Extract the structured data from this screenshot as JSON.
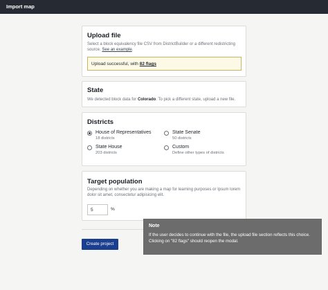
{
  "header": {
    "title": "Import map"
  },
  "upload": {
    "title": "Upload file",
    "description": "Select a block equivalency file CSV from DistrictBuilder or a different redistricting source.",
    "example_link": "See an example",
    "example_suffix": ".",
    "success_prefix": "Upload successful, with ",
    "success_link": "82 flags"
  },
  "state": {
    "title": "State",
    "prefix": "We detected block data for ",
    "state_name": "Colorado",
    "suffix": ". To pick a different state, upload a new file."
  },
  "districts": {
    "title": "Districts",
    "options": [
      {
        "label": "House of Representatives",
        "sub": "18 districts",
        "selected": true
      },
      {
        "label": "State Senate",
        "sub": "50 districts",
        "selected": false
      },
      {
        "label": "State House",
        "sub": "203 districts",
        "selected": false
      },
      {
        "label": "Custom",
        "sub": "Define other types of districts",
        "selected": false
      }
    ]
  },
  "population": {
    "title": "Target population",
    "description": "Depending on whether you are making a map for learning purposes or Ipsum lorem dolor sit amet, consectetur adipisicing elit.",
    "value": "5",
    "unit": "%"
  },
  "actions": {
    "create_label": "Create project"
  },
  "note": {
    "title": "Note",
    "body": "If the user decides to continue with the file, the upload file section reflects this choice. Clicking on \"82 flags\" should reopen the modal."
  },
  "colors": {
    "header_bg": "#262a33",
    "primary": "#1b3f8f",
    "success_bg": "#fdf9e7",
    "success_border": "#c9b35d",
    "note_bg": "#6c6c6c"
  }
}
